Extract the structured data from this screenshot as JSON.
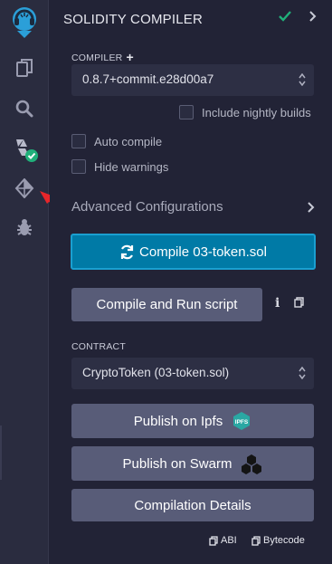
{
  "sidebar": {
    "icons": [
      "remix-logo-icon",
      "file-explorer-icon",
      "search-icon",
      "solidity-compiler-icon",
      "deploy-run-icon",
      "debugger-icon"
    ],
    "colors": {
      "rail_bg": "#2a2c3f",
      "logo": "#2b9fd8",
      "badge": "#20b07a",
      "arrow": "#e8262a"
    }
  },
  "header": {
    "title": "SOLIDITY COMPILER"
  },
  "compiler": {
    "label": "COMPILER",
    "version": "0.8.7+commit.e28d00a7",
    "nightly_label": "Include nightly builds"
  },
  "options": {
    "auto_compile": "Auto compile",
    "hide_warnings": "Hide warnings"
  },
  "advanced": {
    "label": "Advanced Configurations"
  },
  "actions": {
    "compile_label": "Compile 03-token.sol",
    "run_label": "Compile and Run script",
    "info_glyph": "i"
  },
  "contract": {
    "label": "CONTRACT",
    "selected": "CryptoToken (03-token.sol)"
  },
  "publish": {
    "ipfs_label": "Publish on Ipfs",
    "swarm_label": "Publish on Swarm",
    "details_label": "Compilation Details",
    "ipfs_badge": "IPFS"
  },
  "footer": {
    "abi_label": "ABI",
    "bytecode_label": "Bytecode"
  },
  "colors": {
    "panel_bg": "#222336",
    "primary": "#007aa6",
    "secondary": "#585c78",
    "success": "#20b07a"
  }
}
